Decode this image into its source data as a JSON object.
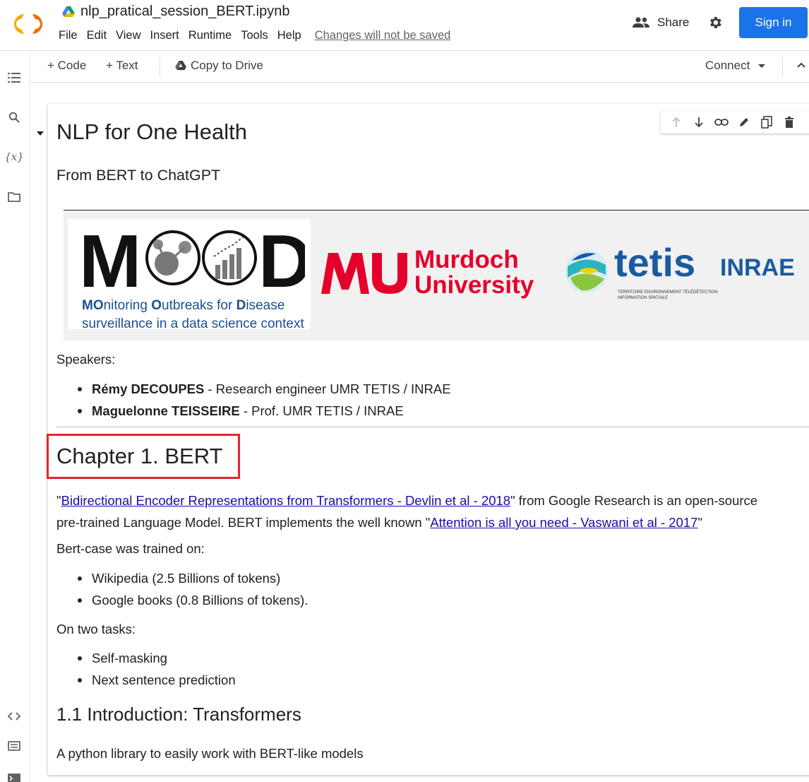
{
  "header": {
    "notebook_title": "nlp_pratical_session_BERT.ipynb",
    "menu": [
      "File",
      "Edit",
      "View",
      "Insert",
      "Runtime",
      "Tools",
      "Help"
    ],
    "unsaved_notice": "Changes will not be saved",
    "share_label": "Share",
    "signin_label": "Sign in",
    "brand_color": "#1a73e8"
  },
  "toolbar": {
    "code_label": "+ Code",
    "text_label": "+ Text",
    "copy_label": "Copy to Drive",
    "connect_label": "Connect"
  },
  "left_rail": {
    "icons": [
      "table-of-contents-icon",
      "search-icon",
      "variables-icon",
      "files-icon",
      "code-snippets-icon",
      "command-palette-icon",
      "terminal-icon"
    ],
    "variables_glyph": "{x}"
  },
  "cell": {
    "title": "NLP for One Health",
    "subtitle": "From BERT to ChatGPT",
    "logos": {
      "mood_letters": "MOOD",
      "mood_line1_a": "MO",
      "mood_line1_b": "nitoring ",
      "mood_line1_c": "O",
      "mood_line1_d": "utbreaks for ",
      "mood_line1_e": "D",
      "mood_line1_f": "isease",
      "mood_line2": "surveillance in a data science context",
      "murdoch_1": "Murdoch",
      "murdoch_2": "University",
      "tetis": "tetis",
      "tetis_tagline_1": "TERRITOIRE ENVIRONNEMENT TÉLÉDÉTECTION",
      "tetis_tagline_2": "INFORMATION SPATIALE",
      "inrae": "INRAE"
    },
    "speakers_label": "Speakers:",
    "speakers": [
      {
        "name": "Rémy DECOUPES",
        "role": " - Research engineer UMR TETIS / INRAE"
      },
      {
        "name": "Maguelonne TEISSEIRE",
        "role": " - Prof. UMR TETIS / INRAE"
      }
    ],
    "chapter_title": "Chapter 1. BERT",
    "para1": {
      "q1": "\"",
      "link1": "Bidirectional Encoder Representations from Transformers - Devlin et al - 2018",
      "after_link1": "\" from Google Research is an open-source",
      "line2_pre": "pre-trained Language Model. BERT implements the well known \"",
      "link2": "Attention is all you need - Vaswani et al - 2017",
      "q2": "\""
    },
    "trained_label": "Bert-case was trained on:",
    "trained_on": [
      "Wikipedia (2.5 Billions of tokens)",
      "Google books (0.8 Billions of tokens)."
    ],
    "tasks_label": "On two tasks:",
    "tasks": [
      "Self-masking",
      "Next sentence prediction"
    ],
    "section_title": "1.1 Introduction: Transformers",
    "intro_line": "A python library to easily work with BERT-like models"
  },
  "highlight_color": "#e3262b"
}
